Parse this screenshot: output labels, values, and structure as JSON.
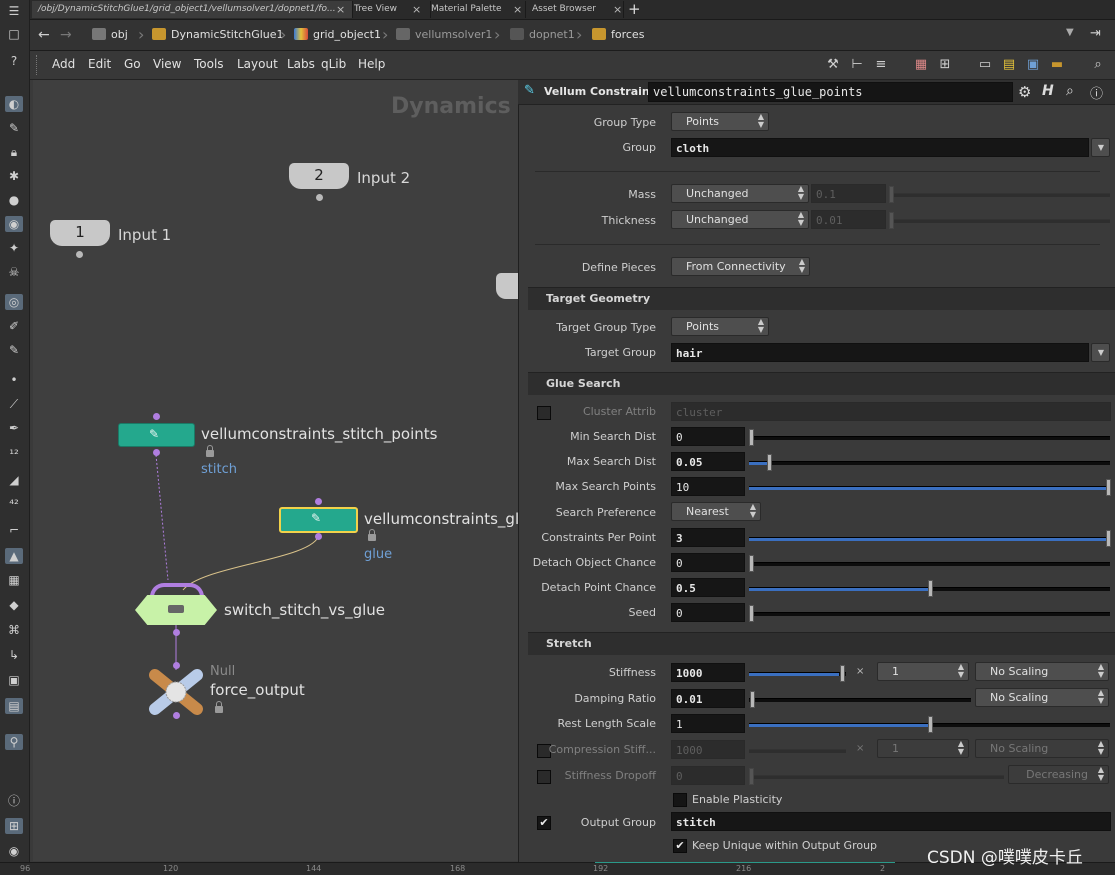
{
  "tabs": [
    {
      "label": "/obj/DynamicStitchGlue1/grid_object1/vellumsolver1/dopnet1/fo...",
      "active": true
    },
    {
      "label": "Tree View",
      "active": false
    },
    {
      "label": "Material Palette",
      "active": false
    },
    {
      "label": "Asset Browser",
      "active": false
    }
  ],
  "tab_close": "×",
  "tab_add": "+",
  "breadcrumbs": [
    {
      "label": "obj"
    },
    {
      "label": "DynamicStitchGlue1"
    },
    {
      "label": "grid_object1"
    },
    {
      "label": "vellumsolver1"
    },
    {
      "label": "dopnet1"
    },
    {
      "label": "forces"
    }
  ],
  "menu": [
    "Add",
    "Edit",
    "Go",
    "View",
    "Tools",
    "Layout",
    "Labs",
    "qLib",
    "Help"
  ],
  "network": {
    "context": "Dynamics",
    "input1": {
      "num": "1",
      "label": "Input 1"
    },
    "input2": {
      "num": "2",
      "label": "Input 2"
    },
    "stitch_node": {
      "name": "vellumconstraints_stitch_points",
      "sub": "stitch"
    },
    "glue_node": {
      "name": "vellumconstraints_glue_points",
      "sub": "glue"
    },
    "switch_node": {
      "name": "switch_stitch_vs_glue"
    },
    "null_node": {
      "type": "Null",
      "name": "force_output"
    }
  },
  "ruler": [
    "96",
    "120",
    "144",
    "168",
    "192",
    "216",
    "2"
  ],
  "parm": {
    "op_type": "Vellum Constraints",
    "node_name": "vellumconstraints_glue_points",
    "group_type": {
      "label": "Group Type",
      "value": "Points"
    },
    "group": {
      "label": "Group",
      "value": "cloth"
    },
    "mass": {
      "label": "Mass",
      "mode": "Unchanged",
      "value": "0.1"
    },
    "thickness": {
      "label": "Thickness",
      "mode": "Unchanged",
      "value": "0.01"
    },
    "define_pieces": {
      "label": "Define Pieces",
      "value": "From Connectivity"
    },
    "target_section": "Target Geometry",
    "target_group_type": {
      "label": "Target Group Type",
      "value": "Points"
    },
    "target_group": {
      "label": "Target Group",
      "value": "hair"
    },
    "glue_section": "Glue Search",
    "cluster_attrib": {
      "label": "Cluster Attrib",
      "value": "cluster"
    },
    "min_search_dist": {
      "label": "Min Search Dist",
      "value": "0",
      "level": 0.0
    },
    "max_search_dist": {
      "label": "Max Search Dist",
      "value": "0.05",
      "level": 0.05
    },
    "max_search_points": {
      "label": "Max Search Points",
      "value": "10",
      "level": 1.0
    },
    "search_pref": {
      "label": "Search Preference",
      "value": "Nearest"
    },
    "constraints_per_point": {
      "label": "Constraints Per Point",
      "value": "3",
      "level": 1.0
    },
    "detach_object": {
      "label": "Detach Object Chance",
      "value": "0",
      "level": 0.0
    },
    "detach_point": {
      "label": "Detach Point Chance",
      "value": "0.5",
      "level": 0.5
    },
    "seed": {
      "label": "Seed",
      "value": "0",
      "level": 0.0
    },
    "stretch_section": "Stretch",
    "stiffness": {
      "label": "Stiffness",
      "value": "1000",
      "mult": "1",
      "scaling": "No Scaling"
    },
    "damping": {
      "label": "Damping Ratio",
      "value": "0.01",
      "scaling": "No Scaling"
    },
    "rest_length_scale": {
      "label": "Rest Length Scale",
      "value": "1",
      "level": 0.5
    },
    "compression": {
      "label": "Compression Stiff...",
      "value": "1000",
      "mult": "1",
      "scaling": "No Scaling"
    },
    "stiffness_dropoff": {
      "label": "Stiffness Dropoff",
      "value": "0",
      "mode": "Decreasing"
    },
    "enable_plasticity": {
      "label": "Enable Plasticity",
      "checked": false
    },
    "output_group": {
      "label": "Output Group",
      "value": "stitch"
    },
    "keep_unique": {
      "label": "Keep Unique within Output Group",
      "checked": true
    },
    "times": "×"
  },
  "watermark": "CSDN @噗噗皮卡丘"
}
